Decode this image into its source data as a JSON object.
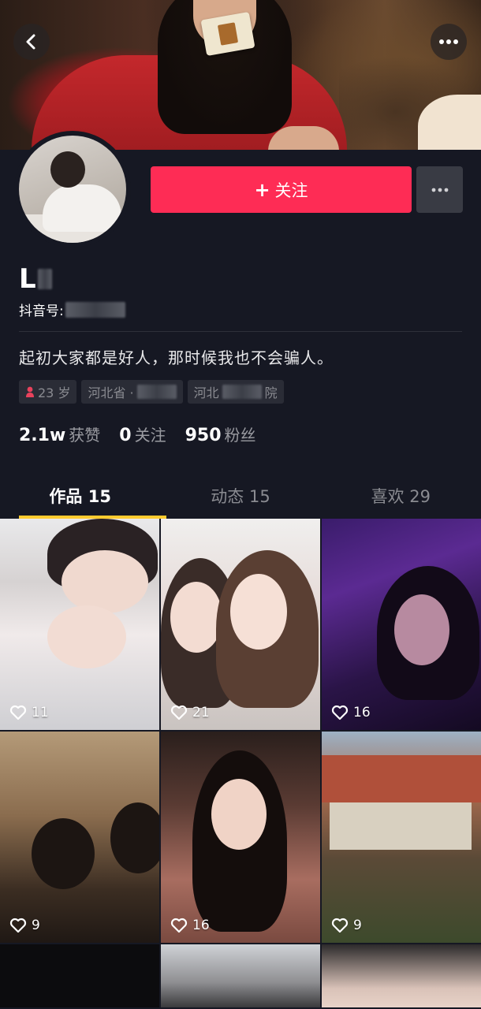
{
  "banner": {
    "back_icon": "chevron-left-icon",
    "more_icon": "ellipsis-icon"
  },
  "profile": {
    "follow_label": "关注",
    "nickname_visible": "L",
    "douyin_id_label": "抖音号:",
    "bio": "起初大家都是好人，那时候我也不会骗人。",
    "tags": {
      "age": "23 岁",
      "location_prefix": "河北省 ·",
      "school_prefix": "河北",
      "school_suffix": "院"
    },
    "stats": [
      {
        "num": "2.1w",
        "label": "获赞"
      },
      {
        "num": "0",
        "label": "关注"
      },
      {
        "num": "950",
        "label": "粉丝"
      }
    ],
    "accent_color": "#fe2c55",
    "tab_underline_color": "#fecb2f"
  },
  "tabs": [
    {
      "label": "作品 15",
      "active": true
    },
    {
      "label": "动态 15",
      "active": false
    },
    {
      "label": "喜欢 29",
      "active": false
    }
  ],
  "videos": [
    {
      "likes": "11"
    },
    {
      "likes": "21"
    },
    {
      "likes": "16"
    },
    {
      "likes": "9"
    },
    {
      "likes": "16"
    },
    {
      "likes": "9"
    }
  ]
}
